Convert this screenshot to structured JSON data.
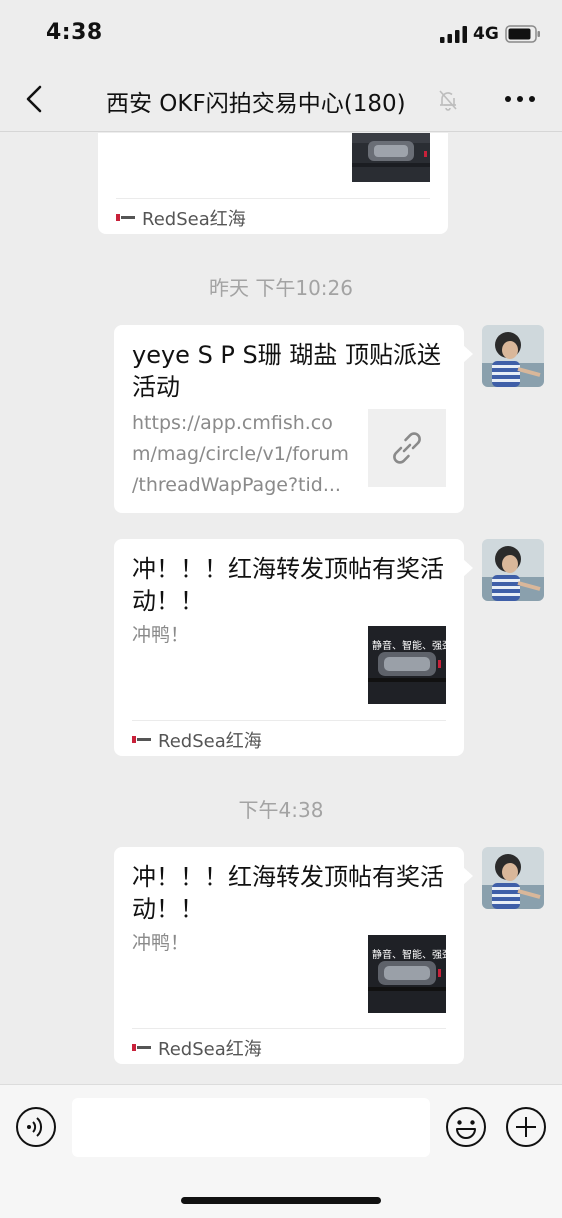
{
  "status_bar": {
    "time": "4:38",
    "network": "4G",
    "icons": [
      "signal-icon",
      "battery-icon"
    ]
  },
  "nav": {
    "title": "西安 OKF闪拍交易中心(180)",
    "icons": [
      "back-icon",
      "mute-icon",
      "more-icon"
    ]
  },
  "messages": {
    "top_card": {
      "source": "RedSea红海"
    },
    "timestamp_1": "昨天 下午10:26",
    "link_card": {
      "title": "yeye S P S珊 瑚盐 顶贴派送活动",
      "url_lines": [
        "https://app.cmfish.co",
        "m/mag/circle/v1/forum",
        "/threadWapPage?tid..."
      ],
      "thumb_icon": "link-icon"
    },
    "card_2": {
      "title": "冲！！！红海转发顶帖有奖活动！！",
      "desc": "冲鸭！",
      "thumb_text": "静音、智能、强劲",
      "source": "RedSea红海"
    },
    "timestamp_2": "下午4:38",
    "card_3": {
      "title": "冲！！！红海转发顶帖有奖活动！！",
      "desc": "冲鸭！",
      "thumb_text": "静音、智能、强劲",
      "source": "RedSea红海"
    }
  },
  "input_bar": {
    "placeholder": "",
    "icons": [
      "voice-icon",
      "emoji-icon",
      "plus-icon"
    ]
  },
  "colors": {
    "background": "#ededed",
    "card": "#ffffff",
    "timestamp": "#a3a3a3",
    "link_text": "#8a8a8a"
  }
}
